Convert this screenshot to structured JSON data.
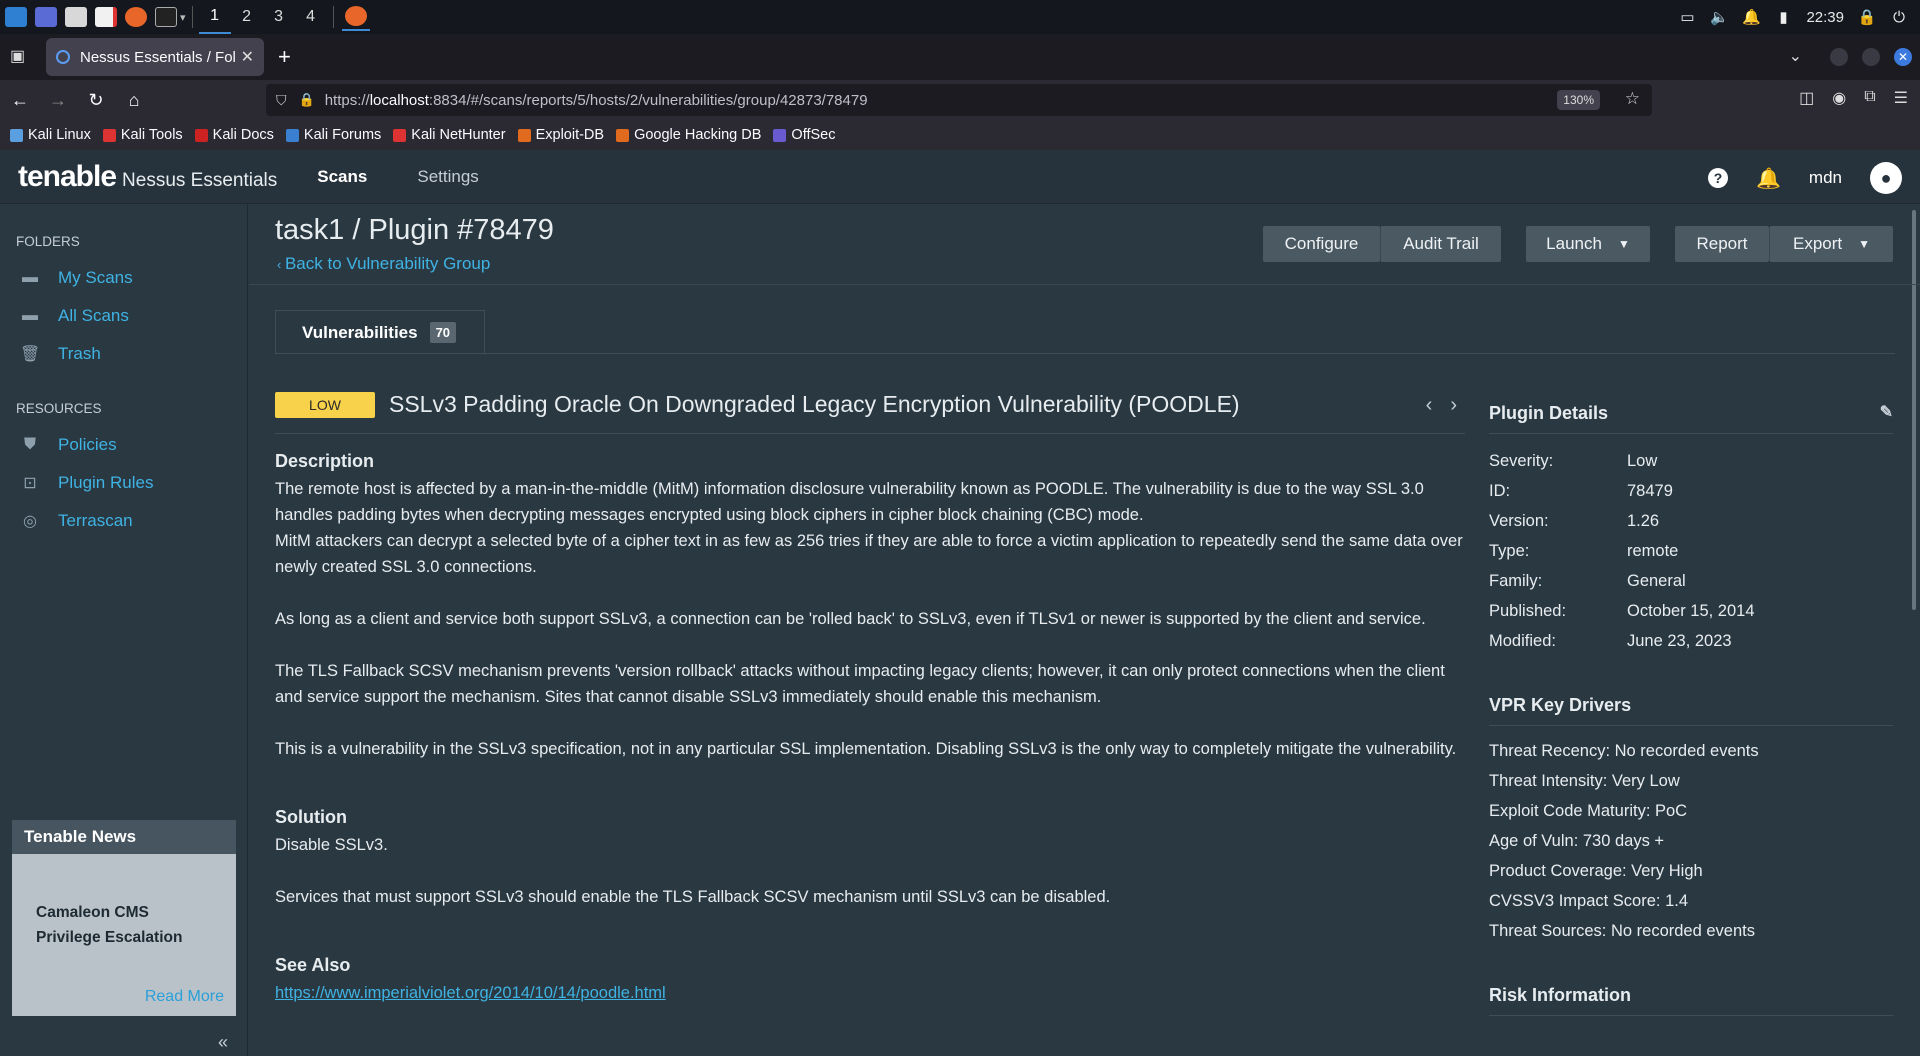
{
  "taskbar": {
    "workspaces": [
      "1",
      "2",
      "3",
      "4"
    ],
    "clock": "22:39"
  },
  "browser": {
    "tab_title": "Nessus Essentials / Folde",
    "url_prefix": "https://",
    "url_host": "localhost",
    "url_rest": ":8834/#/scans/reports/5/hosts/2/vulnerabilities/group/42873/78479",
    "zoom": "130%",
    "bookmarks": [
      "Kali Linux",
      "Kali Tools",
      "Kali Docs",
      "Kali Forums",
      "Kali NetHunter",
      "Exploit-DB",
      "Google Hacking DB",
      "OffSec"
    ]
  },
  "header": {
    "brand": "tenable",
    "product": "Nessus Essentials",
    "nav": [
      "Scans",
      "Settings"
    ],
    "username": "mdn"
  },
  "sidebar": {
    "folders_heading": "FOLDERS",
    "folders": [
      "My Scans",
      "All Scans",
      "Trash"
    ],
    "resources_heading": "RESOURCES",
    "resources": [
      "Policies",
      "Plugin Rules",
      "Terrascan"
    ],
    "news": {
      "title": "Tenable News",
      "headline": "Camaleon CMS Privilege Escalation",
      "read_more": "Read More"
    }
  },
  "main": {
    "title": "task1 / Plugin #78479",
    "back": "Back to Vulnerability Group",
    "buttons": {
      "configure": "Configure",
      "audit_trail": "Audit Trail",
      "launch": "Launch",
      "report": "Report",
      "export": "Export"
    },
    "tab_label": "Vulnerabilities",
    "tab_count": "70",
    "severity": "LOW",
    "vuln_name": "SSLv3 Padding Oracle On Downgraded Legacy Encryption Vulnerability (POODLE)",
    "description_heading": "Description",
    "description": [
      "The remote host is affected by a man-in-the-middle (MitM) information disclosure vulnerability known as POODLE. The vulnerability is due to the way SSL 3.0 handles padding bytes when decrypting messages encrypted using block ciphers in cipher block chaining (CBC) mode.",
      "MitM attackers can decrypt a selected byte of a cipher text in as few as 256 tries if they are able to force a victim application to repeatedly send the same data over newly created SSL 3.0 connections.",
      "As long as a client and service both support SSLv3, a connection can be 'rolled back' to SSLv3, even if TLSv1 or newer is supported by the client and service.",
      "The TLS Fallback SCSV mechanism prevents 'version rollback' attacks without impacting legacy clients; however, it can only protect connections when the client and service support the mechanism. Sites that cannot disable SSLv3 immediately should enable this mechanism.",
      "This is a vulnerability in the SSLv3 specification, not in any particular SSL implementation. Disabling SSLv3 is the only way to completely mitigate the vulnerability."
    ],
    "solution_heading": "Solution",
    "solution": [
      "Disable SSLv3.",
      "Services that must support SSLv3 should enable the TLS Fallback SCSV mechanism until SSLv3 can be disabled."
    ],
    "see_also_heading": "See Also",
    "see_also_link": "https://www.imperialviolet.org/2014/10/14/poodle.html"
  },
  "plugin_details": {
    "heading": "Plugin Details",
    "rows": [
      {
        "k": "Severity:",
        "v": "Low"
      },
      {
        "k": "ID:",
        "v": "78479"
      },
      {
        "k": "Version:",
        "v": "1.26"
      },
      {
        "k": "Type:",
        "v": "remote"
      },
      {
        "k": "Family:",
        "v": "General"
      },
      {
        "k": "Published:",
        "v": "October 15, 2014"
      },
      {
        "k": "Modified:",
        "v": "June 23, 2023"
      }
    ]
  },
  "vpr": {
    "heading": "VPR Key Drivers",
    "items": [
      "Threat Recency: No recorded events",
      "Threat Intensity: Very Low",
      "Exploit Code Maturity: PoC",
      "Age of Vuln: 730 days +",
      "Product Coverage: Very High",
      "CVSSV3 Impact Score: 1.4",
      "Threat Sources: No recorded events"
    ]
  },
  "risk": {
    "heading": "Risk Information"
  },
  "colors": {
    "accent": "#3fb3e3",
    "severity_low": "#f7d24a",
    "background": "#2a3842"
  }
}
